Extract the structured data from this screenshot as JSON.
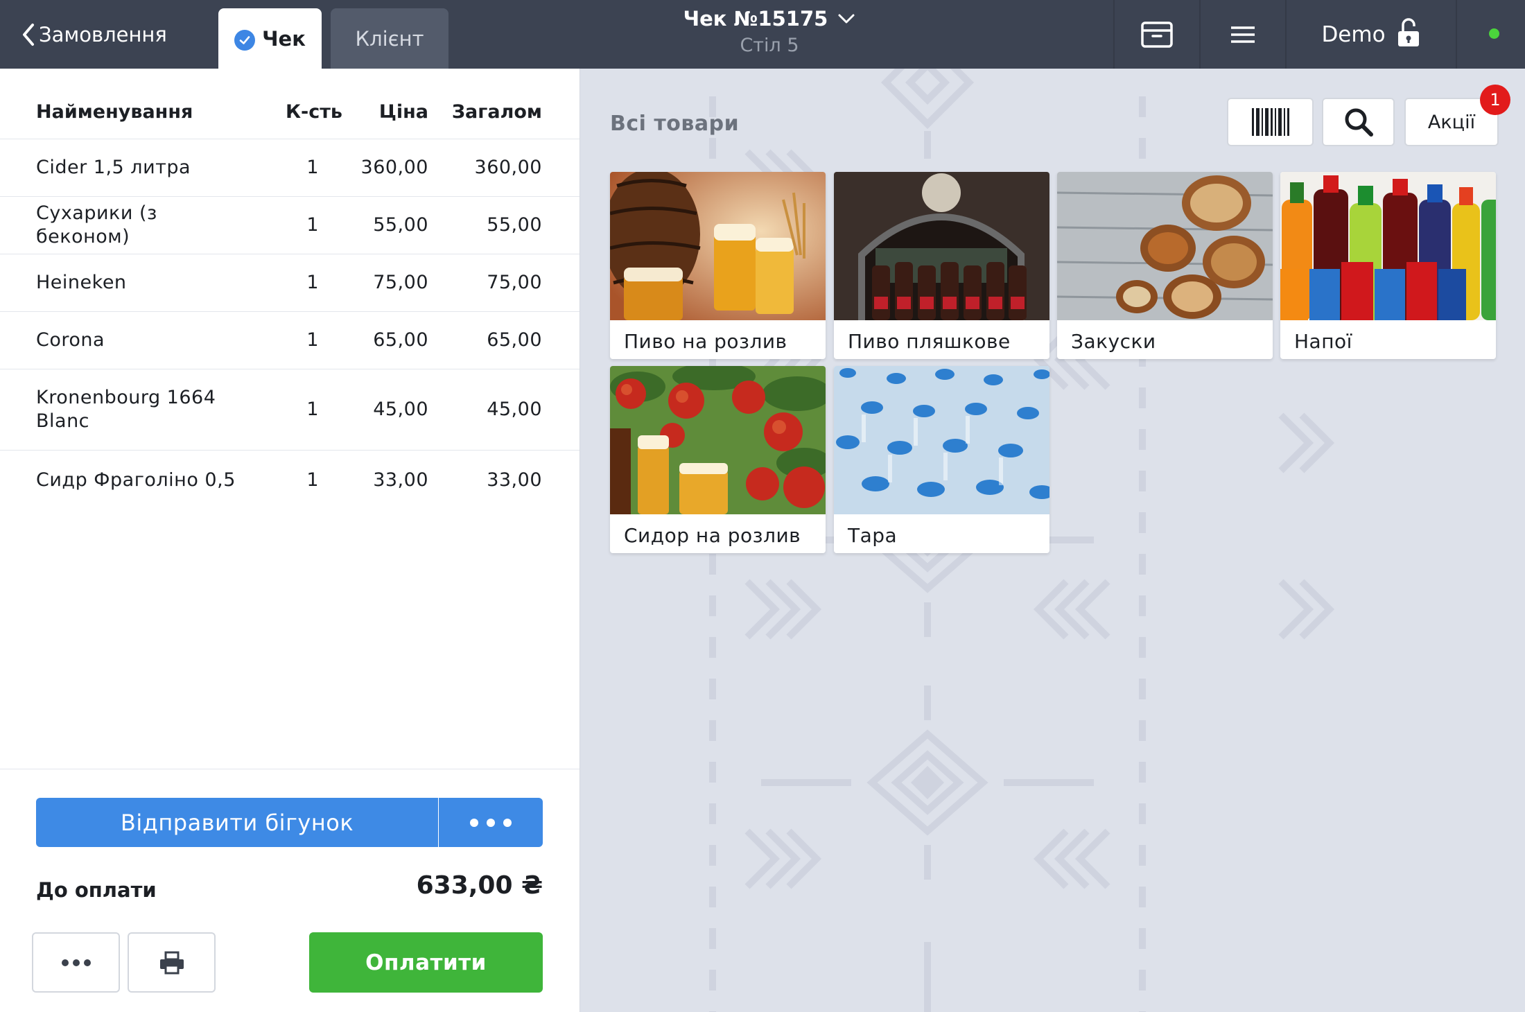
{
  "topbar": {
    "back_label": "Замовлення",
    "tab_check": "Чек",
    "tab_client": "Клієнт",
    "receipt_number": "Чек №15175",
    "table_label": "Стіл 5",
    "user_name": "Demo",
    "status_color": "#4bd43c"
  },
  "receipt": {
    "headers": {
      "name": "Найменування",
      "qty": "К-сть",
      "price": "Ціна",
      "total": "Загалом"
    },
    "rows": [
      {
        "name": "Cider 1,5 литра",
        "qty": "1",
        "price": "360,00",
        "total": "360,00"
      },
      {
        "name": "Сухарики (з беконом)",
        "qty": "1",
        "price": "55,00",
        "total": "55,00"
      },
      {
        "name": "Heineken",
        "qty": "1",
        "price": "75,00",
        "total": "75,00"
      },
      {
        "name": "Corona",
        "qty": "1",
        "price": "65,00",
        "total": "65,00"
      },
      {
        "name": "Kronenbourg 1664 Blanc",
        "qty": "1",
        "price": "45,00",
        "total": "45,00"
      },
      {
        "name": "Сидр Фраголіно 0,5",
        "qty": "1",
        "price": "33,00",
        "total": "33,00"
      }
    ],
    "send_button": "Відправити бігунок",
    "due_label": "До оплати",
    "due_amount": "633,00 ₴",
    "pay_button": "Оплатити"
  },
  "catalog": {
    "title": "Всі товари",
    "promo_label": "Акції",
    "promo_badge": "1",
    "categories": [
      {
        "label": "Пиво на розлив"
      },
      {
        "label": "Пиво пляшкове"
      },
      {
        "label": "Закуски"
      },
      {
        "label": "Напої"
      },
      {
        "label": "Сидор на розлив"
      },
      {
        "label": "Тара"
      }
    ]
  },
  "icons": {
    "back": "chevron-left-icon",
    "check": "checkmark-icon",
    "dropdown": "chevron-down-icon",
    "archive": "archive-box-icon",
    "menu": "hamburger-menu-icon",
    "lock": "unlocked-padlock-icon",
    "barcode": "barcode-icon",
    "search": "search-icon",
    "print": "printer-icon",
    "more": "ellipsis-icon"
  },
  "colors": {
    "topbar": "#3c4352",
    "primary_blue": "#3e8ae5",
    "pay_green": "#3fb53a",
    "badge_red": "#e21b1b",
    "catalog_bg": "#dde1ea"
  }
}
